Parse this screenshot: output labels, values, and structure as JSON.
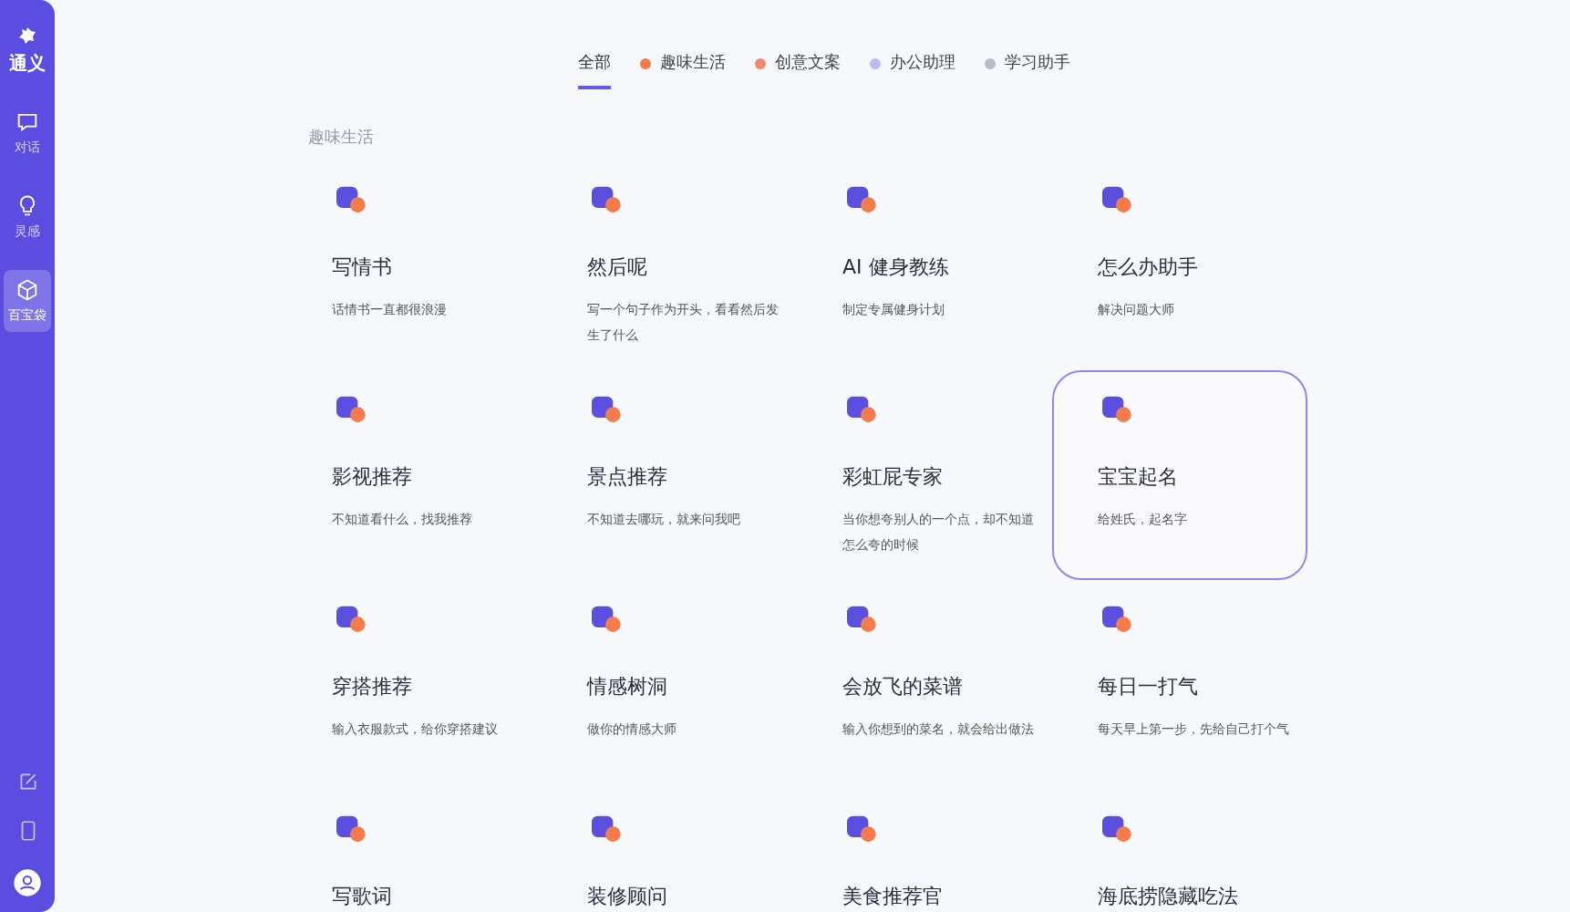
{
  "sidebar": {
    "logo": "通义",
    "items": [
      {
        "label": "对话",
        "selected": false
      },
      {
        "label": "灵感",
        "selected": false
      },
      {
        "label": "百宝袋",
        "selected": true
      }
    ]
  },
  "tabs": [
    {
      "label": "全部",
      "selected": true
    },
    {
      "label": "趣味生活",
      "selected": false,
      "color": "#f47c4a"
    },
    {
      "label": "创意文案",
      "selected": false,
      "color": "#ef8a6e"
    },
    {
      "label": "办公助理",
      "selected": false,
      "color": "#bcbcf2"
    },
    {
      "label": "学习助手",
      "selected": false,
      "color": "#b7bccd"
    }
  ],
  "section": {
    "label": "趣味生活",
    "cards": [
      {
        "title": "写情书",
        "description": "话情书一直都很浪漫",
        "selected": false
      },
      {
        "title": "然后呢",
        "description": "写一个句子作为开头，看看然后发生了什么",
        "selected": false
      },
      {
        "title": "AI 健身教练",
        "description": "制定专属健身计划",
        "selected": false
      },
      {
        "title": "怎么办助手",
        "description": "解决问题大师",
        "selected": false
      },
      {
        "title": "影视推荐",
        "description": "不知道看什么，找我推荐",
        "selected": false
      },
      {
        "title": "景点推荐",
        "description": "不知道去哪玩，就来问我吧",
        "selected": false
      },
      {
        "title": "彩虹屁专家",
        "description": "当你想夸别人的一个点，却不知道怎么夸的时候",
        "selected": false
      },
      {
        "title": "宝宝起名",
        "description": "给姓氏，起名字",
        "selected": true
      },
      {
        "title": "穿搭推荐",
        "description": "输入衣服款式，给你穿搭建议",
        "selected": false
      },
      {
        "title": "情感树洞",
        "description": "做你的情感大师",
        "selected": false
      },
      {
        "title": "会放飞的菜谱",
        "description": "输入你想到的菜名，就会给出做法",
        "selected": false
      },
      {
        "title": "每日一打气",
        "description": "每天早上第一步，先给自己打个气",
        "selected": false
      },
      {
        "title": "写歌词",
        "selected": false
      },
      {
        "title": "装修顾问",
        "selected": false
      },
      {
        "title": "美食推荐官",
        "selected": false
      },
      {
        "title": "海底捞隐藏吃法",
        "selected": false
      }
    ]
  }
}
